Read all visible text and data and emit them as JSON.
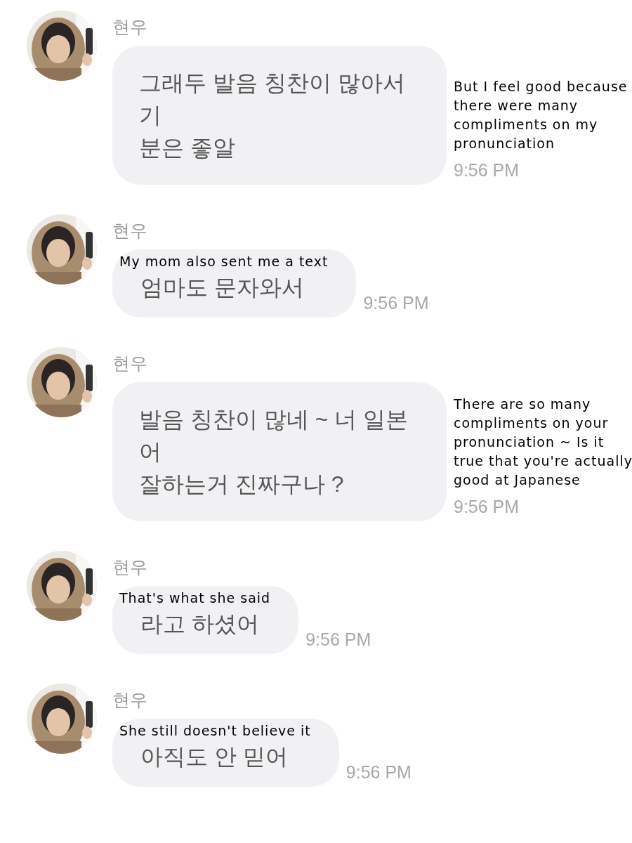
{
  "messages": [
    {
      "sender": "현우",
      "text": "그래두 발음 칭찬이 많아서 기\n분은 좋알",
      "time": "9:56 PM",
      "translation": "But I feel good because there were many compliments on my pronunciation",
      "kind": "beside"
    },
    {
      "sender": "현우",
      "text": "엄마도 문자와서",
      "time": "9:56 PM",
      "translation": "My mom also sent me a text",
      "kind": "above"
    },
    {
      "sender": "현우",
      "text": "발음 칭찬이 많네 ~ 너 일본어\n잘하는거 진짜구나 ?",
      "time": "9:56 PM",
      "translation": "There are so many compliments on your pronunciation ~ Is it true that you're actually good at Japanese",
      "kind": "beside"
    },
    {
      "sender": "현우",
      "text": "라고 하셨어",
      "time": "9:56 PM",
      "translation": "That's what she said",
      "kind": "above"
    },
    {
      "sender": "현우",
      "text": "아직도 안 믿어",
      "time": "9:56 PM",
      "translation": "She still doesn't believe it",
      "kind": "above"
    }
  ]
}
